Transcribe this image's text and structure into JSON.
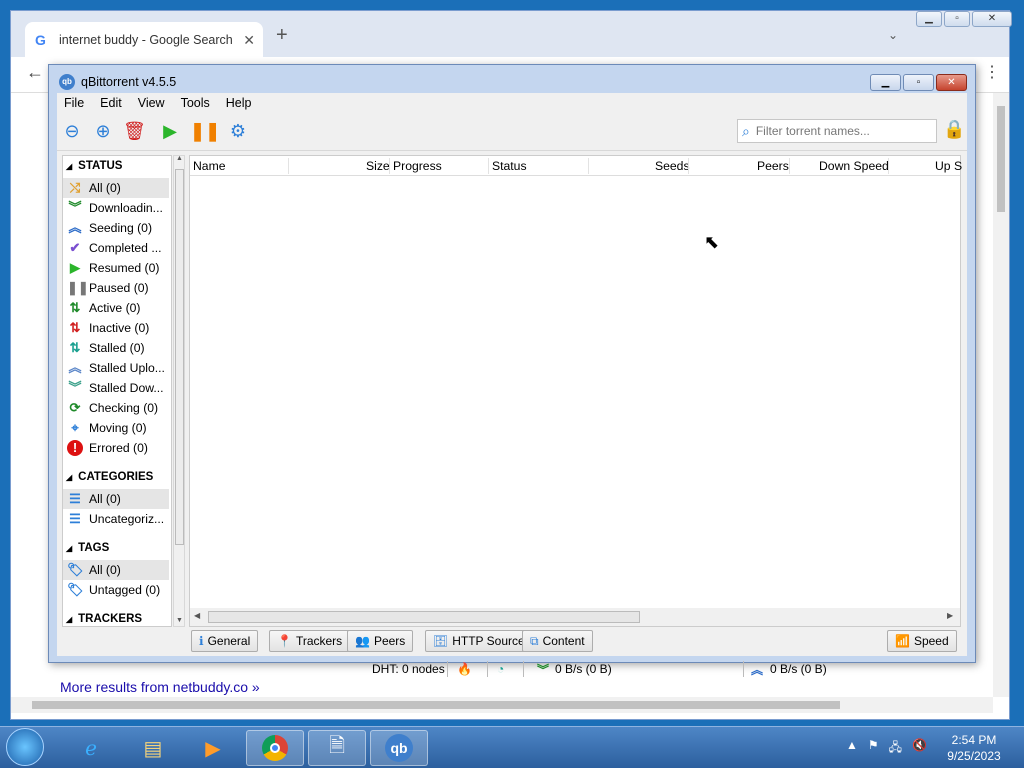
{
  "browser": {
    "tab_title": "internet buddy - Google Search",
    "tab_close": "✕",
    "new_tab": "+",
    "more_results": "More results from netbuddy.co »"
  },
  "qb": {
    "title": "qBittorrent v4.5.5",
    "menu": [
      "File",
      "Edit",
      "View",
      "Tools",
      "Help"
    ],
    "filter_placeholder": "Filter torrent names...",
    "sidebar": {
      "status_header": "STATUS",
      "status_items": [
        {
          "label": "All (0)",
          "icon": "shuffle-icon",
          "color": "#e0a030"
        },
        {
          "label": "Downloadin...",
          "icon": "double-chevron-down-icon",
          "color": "#1f8a2a"
        },
        {
          "label": "Seeding (0)",
          "icon": "double-chevron-up-icon",
          "color": "#2d6cc8"
        },
        {
          "label": "Completed ...",
          "icon": "checkmark-icon",
          "color": "#7a4fd0"
        },
        {
          "label": "Resumed (0)",
          "icon": "play-icon",
          "color": "#2bb52b"
        },
        {
          "label": "Paused (0)",
          "icon": "pause-icon",
          "color": "#777777"
        },
        {
          "label": "Active (0)",
          "icon": "updown-arrows-icon",
          "color": "#1f8a2a"
        },
        {
          "label": "Inactive (0)",
          "icon": "updown-arrows-red-icon",
          "color": "#d02020"
        },
        {
          "label": "Stalled (0)",
          "icon": "updown-arrows-teal-icon",
          "color": "#1aa090"
        },
        {
          "label": "Stalled Uplo...",
          "icon": "double-chevron-up-icon",
          "color": "#5b86c8"
        },
        {
          "label": "Stalled Dow...",
          "icon": "double-chevron-down-icon",
          "color": "#3aa08a"
        },
        {
          "label": "Checking (0)",
          "icon": "refresh-icon",
          "color": "#1f8a2a"
        },
        {
          "label": "Moving (0)",
          "icon": "crosshair-icon",
          "color": "#2d7fd8"
        },
        {
          "label": "Errored (0)",
          "icon": "error-icon",
          "color": "#dd1111"
        }
      ],
      "categories_header": "CATEGORIES",
      "category_items": [
        {
          "label": "All (0)",
          "icon": "list-icon",
          "color": "#2d7fd8"
        },
        {
          "label": "Uncategoriz...",
          "icon": "list-icon",
          "color": "#2d7fd8"
        }
      ],
      "tags_header": "TAGS",
      "tag_items": [
        {
          "label": "All (0)",
          "icon": "tag-icon",
          "color": "#2d7fd8"
        },
        {
          "label": "Untagged (0)",
          "icon": "tag-icon",
          "color": "#2d7fd8"
        }
      ],
      "trackers_header": "TRACKERS"
    },
    "columns": [
      "Name",
      "Size",
      "Progress",
      "Status",
      "Seeds",
      "Peers",
      "Down Speed",
      "Up S"
    ],
    "bottom_tabs": [
      "General",
      "Trackers",
      "Peers",
      "HTTP Sources",
      "Content"
    ],
    "speed_button": "Speed",
    "status": {
      "dht": "DHT: 0 nodes",
      "down": "0 B/s (0 B)",
      "up": "0 B/s (0 B)"
    }
  },
  "taskbar": {
    "time": "2:54 PM",
    "date": "9/25/2023",
    "qb_label": "qb"
  }
}
